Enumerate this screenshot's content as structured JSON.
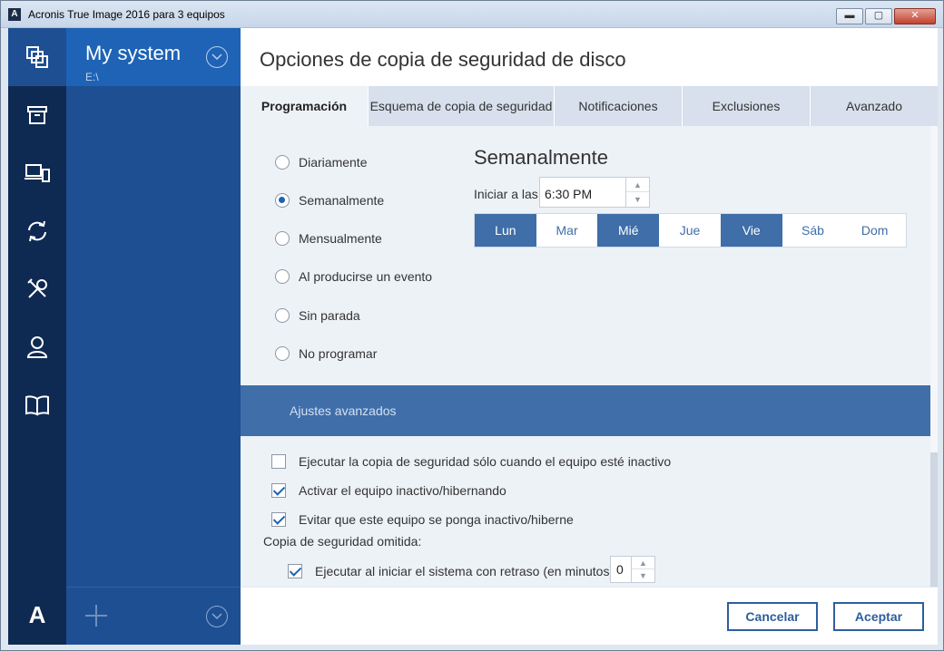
{
  "window": {
    "title": "Acronis True Image 2016 para 3 equipos",
    "app_icon_letter": "A",
    "minimize": "▬",
    "maximize": "▢",
    "close": "✕"
  },
  "rail": {
    "items": [
      "backup-icon",
      "archive-icon",
      "devices-icon",
      "sync-icon",
      "tools-icon",
      "account-icon",
      "help-book-icon"
    ],
    "logo": "A"
  },
  "backup_list": {
    "name": "My system",
    "path": "E:\\"
  },
  "main": {
    "title": "Opciones de copia de seguridad de disco",
    "tabs": [
      {
        "label": "Programación"
      },
      {
        "label": "Esquema de copia de seguridad"
      },
      {
        "label": "Notificaciones"
      },
      {
        "label": "Exclusiones"
      },
      {
        "label": "Avanzado"
      }
    ]
  },
  "schedule": {
    "options": [
      {
        "label": "Diariamente",
        "selected": false
      },
      {
        "label": "Semanalmente",
        "selected": true
      },
      {
        "label": "Mensualmente",
        "selected": false
      },
      {
        "label": "Al producirse un evento",
        "selected": false
      },
      {
        "label": "Sin parada",
        "selected": false
      },
      {
        "label": "No programar",
        "selected": false
      }
    ],
    "weekly_title": "Semanalmente",
    "start_label": "Iniciar a las",
    "start_time": "6:30 PM",
    "days": [
      {
        "label": "Lun",
        "selected": true
      },
      {
        "label": "Mar",
        "selected": false
      },
      {
        "label": "Mié",
        "selected": true
      },
      {
        "label": "Jue",
        "selected": false
      },
      {
        "label": "Vie",
        "selected": true
      },
      {
        "label": "Sáb",
        "selected": false
      },
      {
        "label": "Dom",
        "selected": false
      }
    ]
  },
  "advanced": {
    "header": "Ajustes avanzados",
    "checks": [
      {
        "label": "Ejecutar la copia de seguridad sólo cuando el equipo esté inactivo",
        "checked": false
      },
      {
        "label": "Activar el equipo inactivo/hibernando",
        "checked": true
      },
      {
        "label": "Evitar que este equipo se ponga inactivo/hiberne",
        "checked": true
      }
    ],
    "omitted_label": "Copia de seguridad omitida:",
    "delay_check": {
      "label": "Ejecutar al iniciar el sistema con retraso (en minutos):",
      "checked": true
    },
    "delay_value": "0"
  },
  "footer": {
    "cancel": "Cancelar",
    "accept": "Aceptar"
  },
  "colors": {
    "rail_bg": "#0f2a52",
    "accent": "#1e63b5",
    "day_selected": "#3f6ea9"
  }
}
